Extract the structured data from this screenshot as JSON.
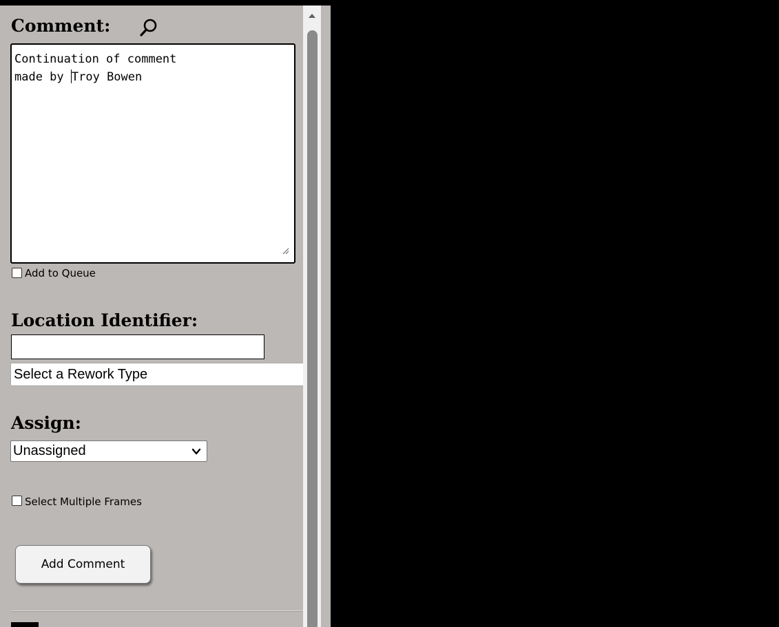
{
  "comment_section": {
    "heading": "Comment:",
    "search_icon": "search-icon",
    "text_before_caret": "Continuation of comment\nmade by ",
    "text_after_caret": "Troy Bowen"
  },
  "queue": {
    "label": "Add to Queue",
    "checked": false
  },
  "location_section": {
    "heading": "Location Identifier:",
    "value": ""
  },
  "rework_select": {
    "selected": "Select a Rework Type"
  },
  "assign_section": {
    "heading": "Assign:",
    "selected": "Unassigned"
  },
  "multi_frames": {
    "label": "Select Multiple Frames",
    "checked": false
  },
  "actions": {
    "add_comment_label": "Add Comment"
  },
  "colors": {
    "panel_background": "#bcb8b5",
    "viewer_background": "#000000"
  }
}
